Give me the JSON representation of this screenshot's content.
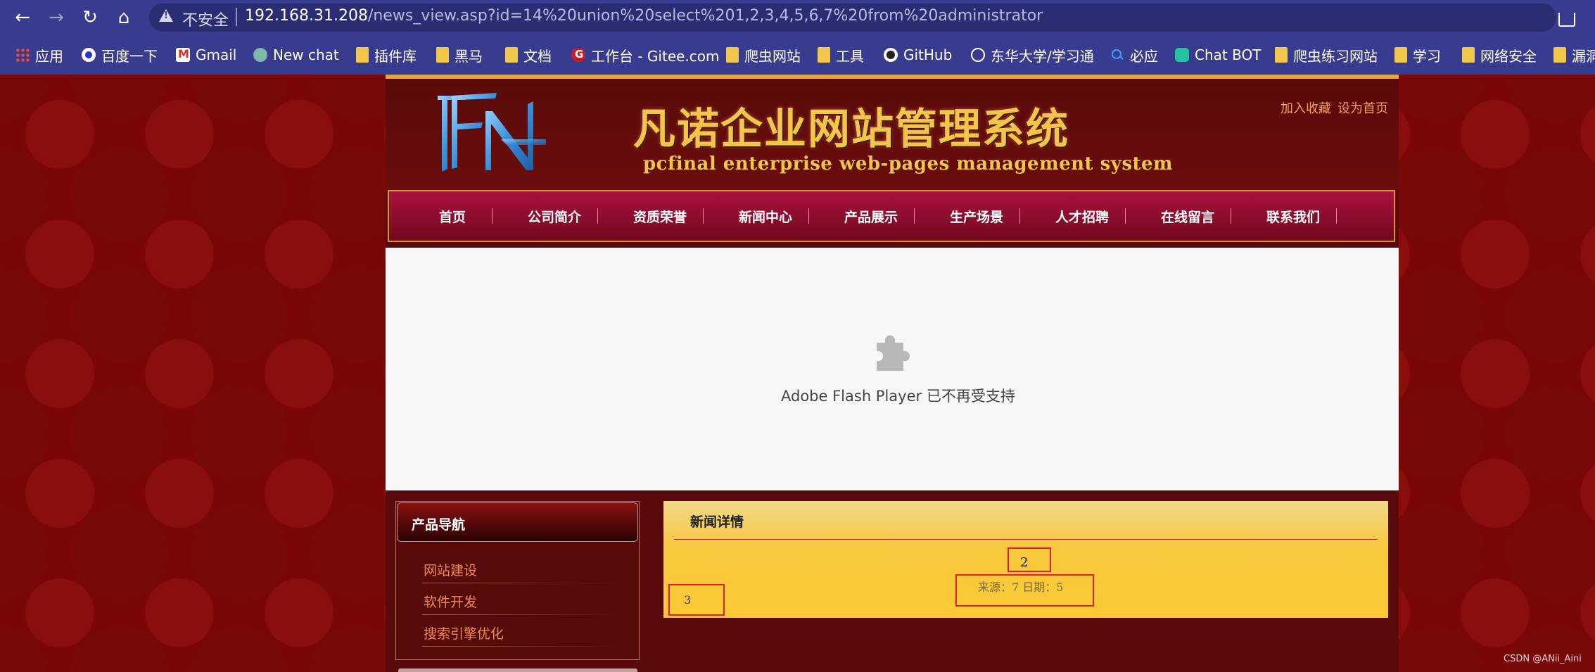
{
  "browser": {
    "insecure_label": "不安全",
    "url_host": "192.168.31.208",
    "url_rest": "/news_view.asp?id=14%20union%20select%201,2,3,4,5,6,7%20from%20administrator"
  },
  "bookmarks": [
    {
      "label": "应用",
      "icon": "apps-icon"
    },
    {
      "label": "百度一下",
      "icon": "baidu-icon"
    },
    {
      "label": "Gmail",
      "icon": "gmail-icon"
    },
    {
      "label": "New chat",
      "icon": "chatgpt-icon"
    },
    {
      "label": "插件库",
      "icon": "folder-icon"
    },
    {
      "label": "黑马",
      "icon": "folder-icon"
    },
    {
      "label": "文档",
      "icon": "folder-icon"
    },
    {
      "label": "工作台 - Gitee.com",
      "icon": "gitee-icon"
    },
    {
      "label": "爬虫网站",
      "icon": "folder-icon"
    },
    {
      "label": "工具",
      "icon": "folder-icon"
    },
    {
      "label": "GitHub",
      "icon": "github-icon"
    },
    {
      "label": "东华大学/学习通",
      "icon": "globe-icon"
    },
    {
      "label": "必应",
      "icon": "search-icon"
    },
    {
      "label": "Chat BOT",
      "icon": "chatbot-icon"
    },
    {
      "label": "爬虫练习网站",
      "icon": "folder-icon"
    },
    {
      "label": "学习",
      "icon": "folder-icon"
    },
    {
      "label": "网络安全",
      "icon": "folder-icon"
    },
    {
      "label": "漏洞",
      "icon": "folder-icon"
    }
  ],
  "site": {
    "title_cn": "凡诺企业网站管理系统",
    "title_en": "pcfinal enterprise web-pages management system",
    "add_favorite": "加入收藏",
    "set_homepage": "设为首页",
    "nav": [
      "首页",
      "公司简介",
      "资质荣誉",
      "新闻中心",
      "产品展示",
      "生产场景",
      "人才招聘",
      "在线留言",
      "联系我们"
    ]
  },
  "flash": {
    "message": "Adobe Flash Player 已不再受支持"
  },
  "sidebar": {
    "title": "产品导航",
    "items": [
      "网站建设",
      "软件开发",
      "搜索引擎优化"
    ]
  },
  "news": {
    "heading": "新闻详情",
    "title_value": "2",
    "meta": "来源：7 日期：5",
    "content_value": "3"
  },
  "watermark": "CSDN @ANii_Aini",
  "colors": {
    "browser_bar": "#383c8e",
    "page_red": "#7a0606",
    "nav_crimson": "#a8123d",
    "gold": "#f4c54a",
    "highlight_box": "#e0202a"
  }
}
